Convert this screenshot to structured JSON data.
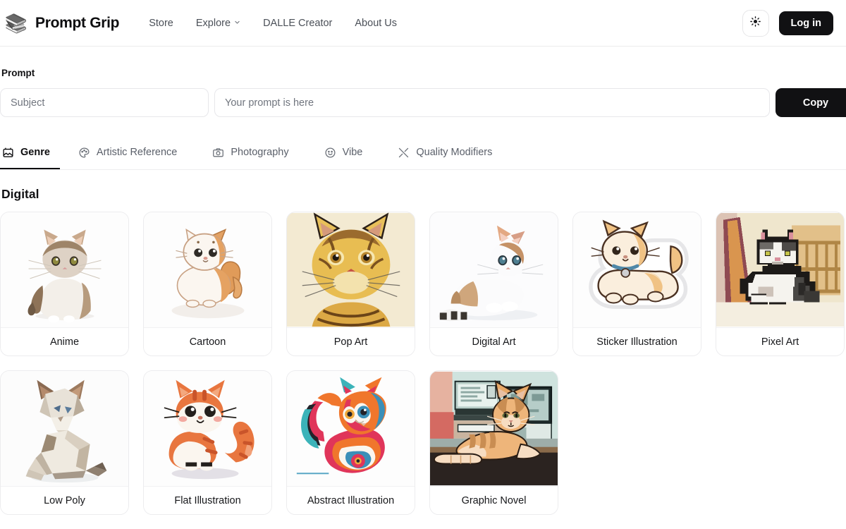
{
  "header": {
    "logo_icon": "stacked-books-icon",
    "brand": "Prompt Grip",
    "nav": [
      {
        "label": "Store",
        "has_dropdown": false
      },
      {
        "label": "Explore",
        "has_dropdown": true
      },
      {
        "label": "DALLE Creator",
        "has_dropdown": false
      },
      {
        "label": "About Us",
        "has_dropdown": false
      }
    ],
    "theme_toggle_icon": "sun-icon",
    "login_label": "Log in"
  },
  "prompt": {
    "label": "Prompt",
    "subject_value": "",
    "subject_placeholder": "Subject",
    "prompt_value": "",
    "prompt_placeholder": "Your prompt is here",
    "copy_label": "Copy"
  },
  "tabs": [
    {
      "label": "Genre",
      "icon": "image-frame-icon",
      "active": true
    },
    {
      "label": "Artistic Reference",
      "icon": "palette-icon",
      "active": false
    },
    {
      "label": "Photography",
      "icon": "camera-icon",
      "active": false
    },
    {
      "label": "Vibe",
      "icon": "smiley-icon",
      "active": false
    },
    {
      "label": "Quality Modifiers",
      "icon": "crossed-tools-icon",
      "active": false
    }
  ],
  "section": {
    "title": "Digital"
  },
  "cards": [
    {
      "label": "Anime",
      "thumb": "anime-cat"
    },
    {
      "label": "Cartoon",
      "thumb": "cartoon-cat"
    },
    {
      "label": "Pop Art",
      "thumb": "popart-cat"
    },
    {
      "label": "Digital Art",
      "thumb": "digitalart-cat"
    },
    {
      "label": "Sticker Illustration",
      "thumb": "sticker-cat"
    },
    {
      "label": "Pixel Art",
      "thumb": "pixelart-cat"
    },
    {
      "label": "Low Poly",
      "thumb": "lowpoly-cat"
    },
    {
      "label": "Flat Illustration",
      "thumb": "flat-cat"
    },
    {
      "label": "Abstract Illustration",
      "thumb": "abstract-cat"
    },
    {
      "label": "Graphic Novel",
      "thumb": "graphicnovel-cat"
    }
  ],
  "colors": {
    "accent": "#111113",
    "text": "#16171a",
    "muted": "#5b606a",
    "border": "#ececee",
    "background": "#ffffff"
  }
}
